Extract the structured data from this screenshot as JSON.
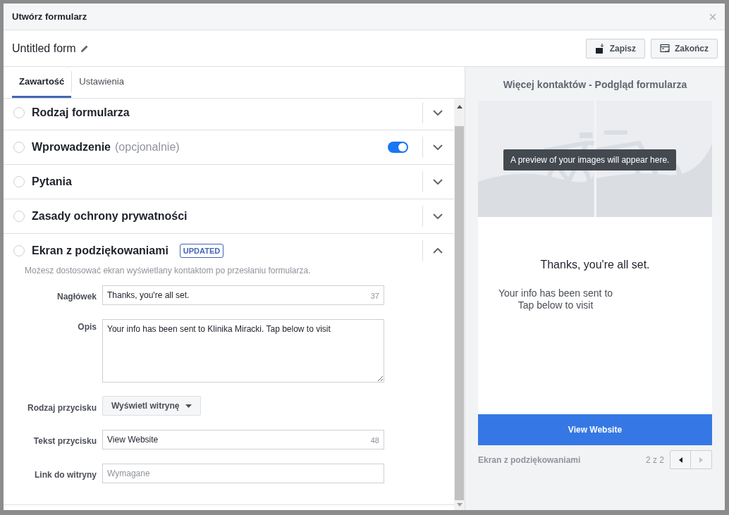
{
  "window": {
    "title": "Utwórz formularz"
  },
  "form_name": "Untitled form",
  "actions": [
    {
      "label": "Zapisz",
      "kind": "save"
    },
    {
      "label": "Zakończ",
      "kind": "finish"
    }
  ],
  "tabs": [
    {
      "label": "Zawartość",
      "selected": true
    },
    {
      "label": "Ustawienia",
      "selected": false
    }
  ],
  "sections": [
    {
      "title": "Rodzaj formularza",
      "checked": false,
      "expanded": false
    },
    {
      "title": "Wprowadzenie",
      "note": "(opcjonalnie)",
      "checked": false,
      "toggle_on": true,
      "expanded": false
    },
    {
      "title": "Pytania",
      "checked": false,
      "expanded": false
    },
    {
      "title": "Zasady ochrony prywatności",
      "checked": false,
      "expanded": false
    },
    {
      "title": "Ekran z podziękowaniami",
      "badge": "UPDATED",
      "checked": false,
      "expanded": true,
      "description": "Możesz dostosować ekran wyświetlany kontaktom po przesłaniu formularza.",
      "fields": [
        {
          "kind": "text",
          "label": "Nagłówek",
          "value": "Thanks, you're all set.",
          "counter": "37"
        },
        {
          "kind": "textarea",
          "label": "Opis",
          "value": "Your info has been sent to Klinika Miracki. Tap below to visit"
        },
        {
          "kind": "select",
          "label": "Rodzaj przycisku",
          "value": "Wyświetl witrynę"
        },
        {
          "kind": "text",
          "label": "Tekst przycisku",
          "value": "View Website",
          "counter": "48"
        },
        {
          "kind": "text",
          "label": "Link do witryny",
          "placeholder": "Wymagane"
        }
      ]
    }
  ],
  "preview": {
    "title": "Więcej kontaktów - Podgląd formularza",
    "image_tooltip": "A preview of your images will appear here.",
    "heading": "Thanks, you're all set.",
    "body_lines": [
      "Your info has been sent to",
      "Tap below to visit"
    ],
    "button": "View Website",
    "screen_name": "Ekran z podziękowaniami",
    "pager": "2 z 2"
  }
}
